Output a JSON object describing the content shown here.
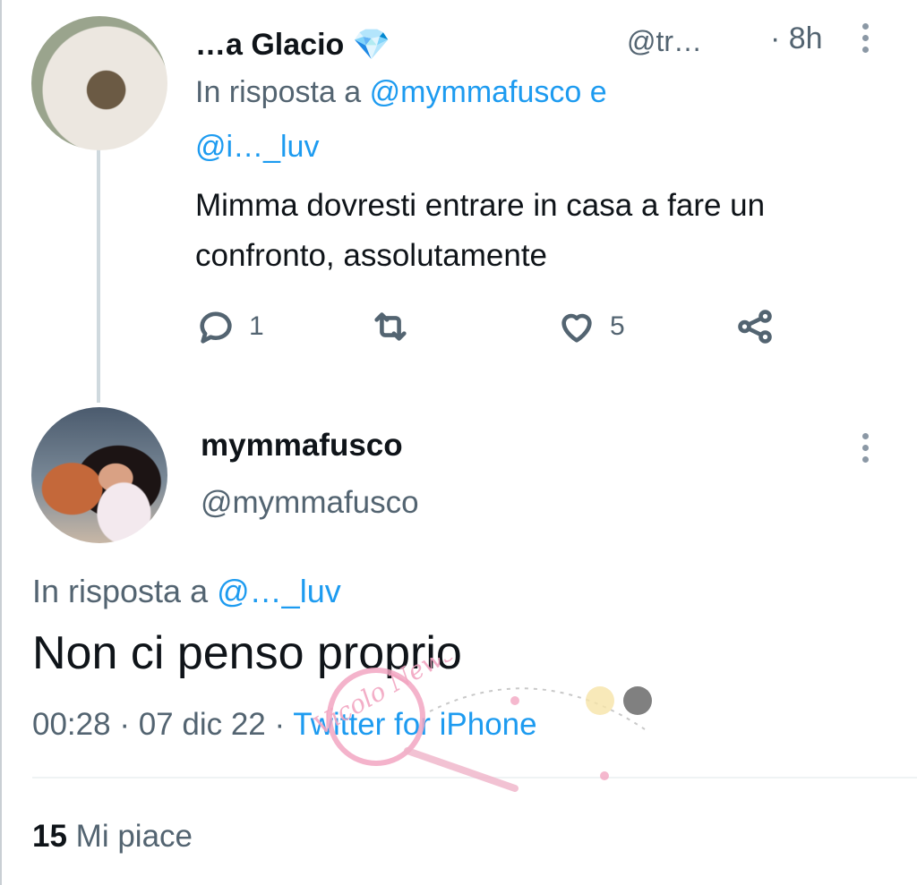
{
  "tweet_parent": {
    "display_name": "…a Glacio",
    "verified_emoji": "💎",
    "handle": "@tr…",
    "time": "· 8h",
    "reply_prefix": "In risposta a",
    "reply_to": "@mymmafusco e",
    "reply_to_2": "@i…_luv",
    "text": "Mimma dovresti entrare in casa a fare un confronto, assolutamente",
    "reply_count": "1",
    "retweet_count": "",
    "like_count": "5",
    "icons": [
      "reply-icon",
      "retweet-icon",
      "like-icon",
      "share-icon",
      "more-icon"
    ]
  },
  "tweet_main": {
    "display_name": "mymmafusco",
    "handle": "@mymmafusco",
    "reply_prefix": "In risposta a",
    "reply_to": "@…_luv",
    "text": "Non ci penso proprio",
    "time": "00:28",
    "date": "07 dic 22",
    "separator": "·",
    "source": "Twitter for iPhone",
    "likes_count": "15",
    "likes_label": "Mi piace"
  },
  "watermark": {
    "text": "Vicolo News"
  },
  "colors": {
    "accent": "#1d9bf0",
    "muted": "#536471",
    "text": "#0f1419",
    "line": "#cfd9de"
  }
}
